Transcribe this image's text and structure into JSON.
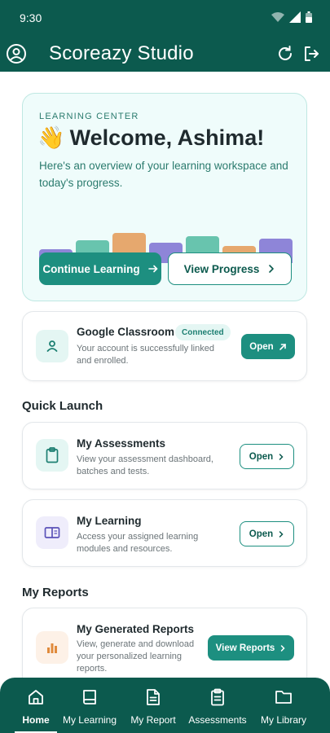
{
  "status_bar": {
    "time": "9:30",
    "icons": [
      "wifi-icon",
      "signal-icon",
      "battery-icon"
    ]
  },
  "app_bar": {
    "title": "Scoreazy Studio",
    "left_icon": "account-icon",
    "right_icons": [
      "refresh-icon",
      "logout-icon"
    ]
  },
  "hero": {
    "eyebrow": "LEARNING CENTER",
    "emoji": "👋",
    "title": "Welcome, Ashima!",
    "subtitle": "Here's an overview of your learning workspace and today's progress.",
    "bars": [
      {
        "level": 0.46,
        "color": "#8e85d8"
      },
      {
        "level": 0.74,
        "color": "#68c4ae"
      },
      {
        "level": 0.97,
        "color": "#e6a86e"
      },
      {
        "level": 0.66,
        "color": "#8e85d8"
      },
      {
        "level": 0.86,
        "color": "#68c4ae"
      },
      {
        "level": 0.54,
        "color": "#e6a86e"
      },
      {
        "level": 0.8,
        "color": "#8e85d8"
      }
    ],
    "primary_cta": "Continue Learning",
    "secondary_cta": "View Progress"
  },
  "classroom_card": {
    "title": "Google Classroom",
    "badge": "Connected",
    "description": "Your account is successfully linked and enrolled.",
    "button": "Open",
    "icon": "person-icon"
  },
  "quick_launch": {
    "heading": "Quick Launch",
    "items": [
      {
        "title": "My Assessments",
        "description": "View your assessment dashboard, batches and tests.",
        "button": "Open",
        "icon": "clipboard-icon"
      },
      {
        "title": "My Learning",
        "description": "Access your assigned learning modules and resources.",
        "button": "Open",
        "icon": "book-open-icon"
      }
    ]
  },
  "reports": {
    "heading": "My Reports",
    "items": [
      {
        "title": "My Generated Reports",
        "description": "View, generate and download your personalized learning reports.",
        "button": "View Reports",
        "icon": "bar-chart-icon"
      }
    ]
  },
  "bottom_nav": {
    "active": "Home",
    "items": [
      {
        "label": "Home",
        "icon": "home-icon"
      },
      {
        "label": "My Learning",
        "icon": "book-icon"
      },
      {
        "label": "My Report",
        "icon": "document-icon"
      },
      {
        "label": "Assessments",
        "icon": "clipboard-icon"
      },
      {
        "label": "My Library",
        "icon": "folder-icon"
      }
    ]
  },
  "colors": {
    "brand": "#0c5a4e",
    "accent": "#1d8f80",
    "hero_background": "#effcfb"
  }
}
